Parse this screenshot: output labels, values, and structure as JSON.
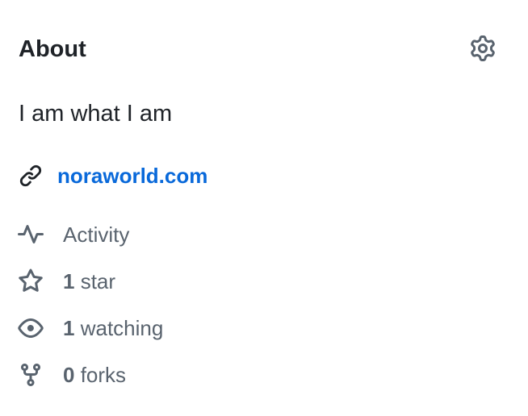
{
  "about": {
    "title": "About",
    "description": "I am what I am",
    "website": "noraworld.com"
  },
  "meta": {
    "activity_label": "Activity",
    "stars_count": "1",
    "stars_label": "star",
    "watching_count": "1",
    "watching_label": "watching",
    "forks_count": "0",
    "forks_label": "forks"
  },
  "icons": {
    "settings": "gear-icon",
    "link": "link-icon",
    "activity": "pulse-icon",
    "star": "star-icon",
    "watch": "eye-icon",
    "fork": "repo-forked-icon"
  },
  "colors": {
    "text": "#1f2328",
    "muted": "#59636e",
    "link": "#0969da"
  }
}
